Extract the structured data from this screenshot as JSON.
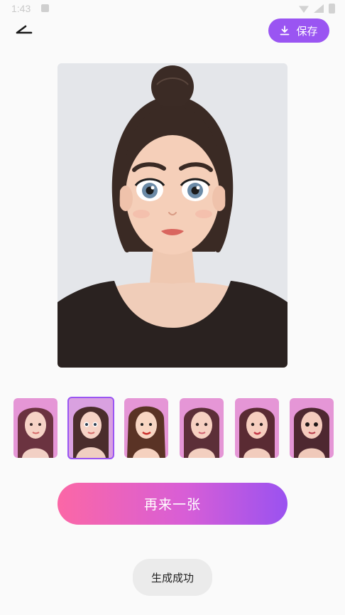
{
  "status_bar": {
    "time": "1:43",
    "icons": [
      "notification-icon",
      "signal-icon",
      "wifi-icon",
      "battery-icon"
    ]
  },
  "header": {
    "back_icon": "back-arrow-icon",
    "save_label": "保存",
    "save_icon": "download-icon"
  },
  "main_image": {
    "description_icon": "cartoon-portrait-image"
  },
  "thumbnails": {
    "count": 6,
    "selected_index": 1,
    "styles": [
      "soft-cartoon",
      "big-eye-cartoon",
      "comic-illustration",
      "soft-3d",
      "glam-3d",
      "doll-3d"
    ]
  },
  "actions": {
    "retry_label": "再来一张"
  },
  "toast": {
    "text": "生成成功"
  },
  "colors": {
    "accent": "#9a55f2",
    "gradient_start": "#fb67a6",
    "gradient_end": "#9a52f0",
    "thumb_bg": "#e596d6"
  }
}
